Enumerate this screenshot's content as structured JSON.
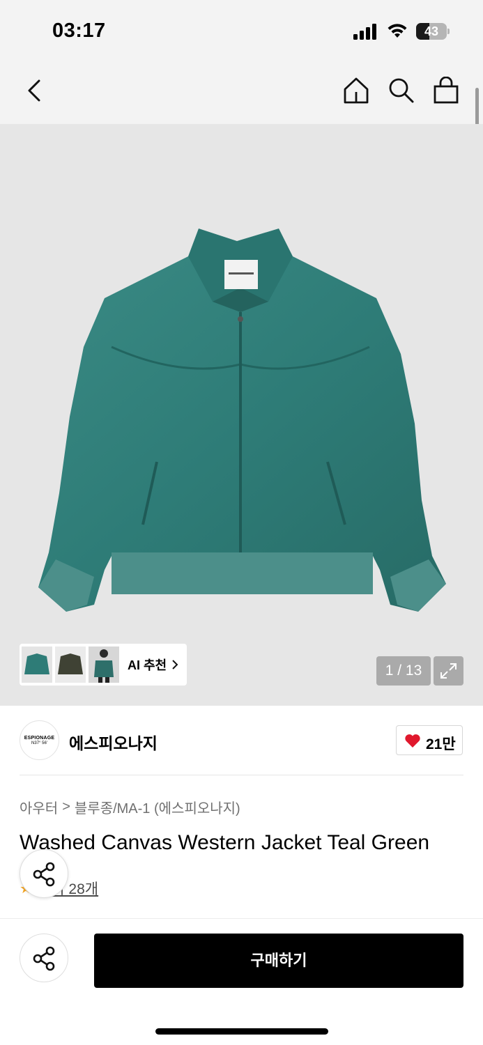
{
  "status_bar": {
    "time": "03:17",
    "battery_percent": "43",
    "battery_level": 0.43
  },
  "nav": {
    "icons": [
      "back-icon",
      "home-icon",
      "search-icon",
      "shopping-bag-icon"
    ]
  },
  "gallery": {
    "ai_label": "AI 추천",
    "pager": "1 / 13",
    "thumbnails": [
      "jacket-green-thumbnail",
      "jacket-dark-thumbnail",
      "model-thumbnail"
    ]
  },
  "brand": {
    "logo_line1": "ESPIONAGE",
    "logo_line2": "N37° 56'",
    "name": "에스피오나지",
    "likes": "21만"
  },
  "breadcrumb": {
    "category": "아우터",
    "separator": ">",
    "subcategory": "블루종/MA-1 (에스피오나지)"
  },
  "product": {
    "title": "Washed Canvas Western Jacket Teal Green",
    "reviews": "후기 28개"
  },
  "actions": {
    "buy_label": "구매하기"
  },
  "colors": {
    "jacket": "#2e7c77",
    "like_heart": "#e0182d",
    "buy_button": "#000000",
    "star": "#f5a623"
  }
}
